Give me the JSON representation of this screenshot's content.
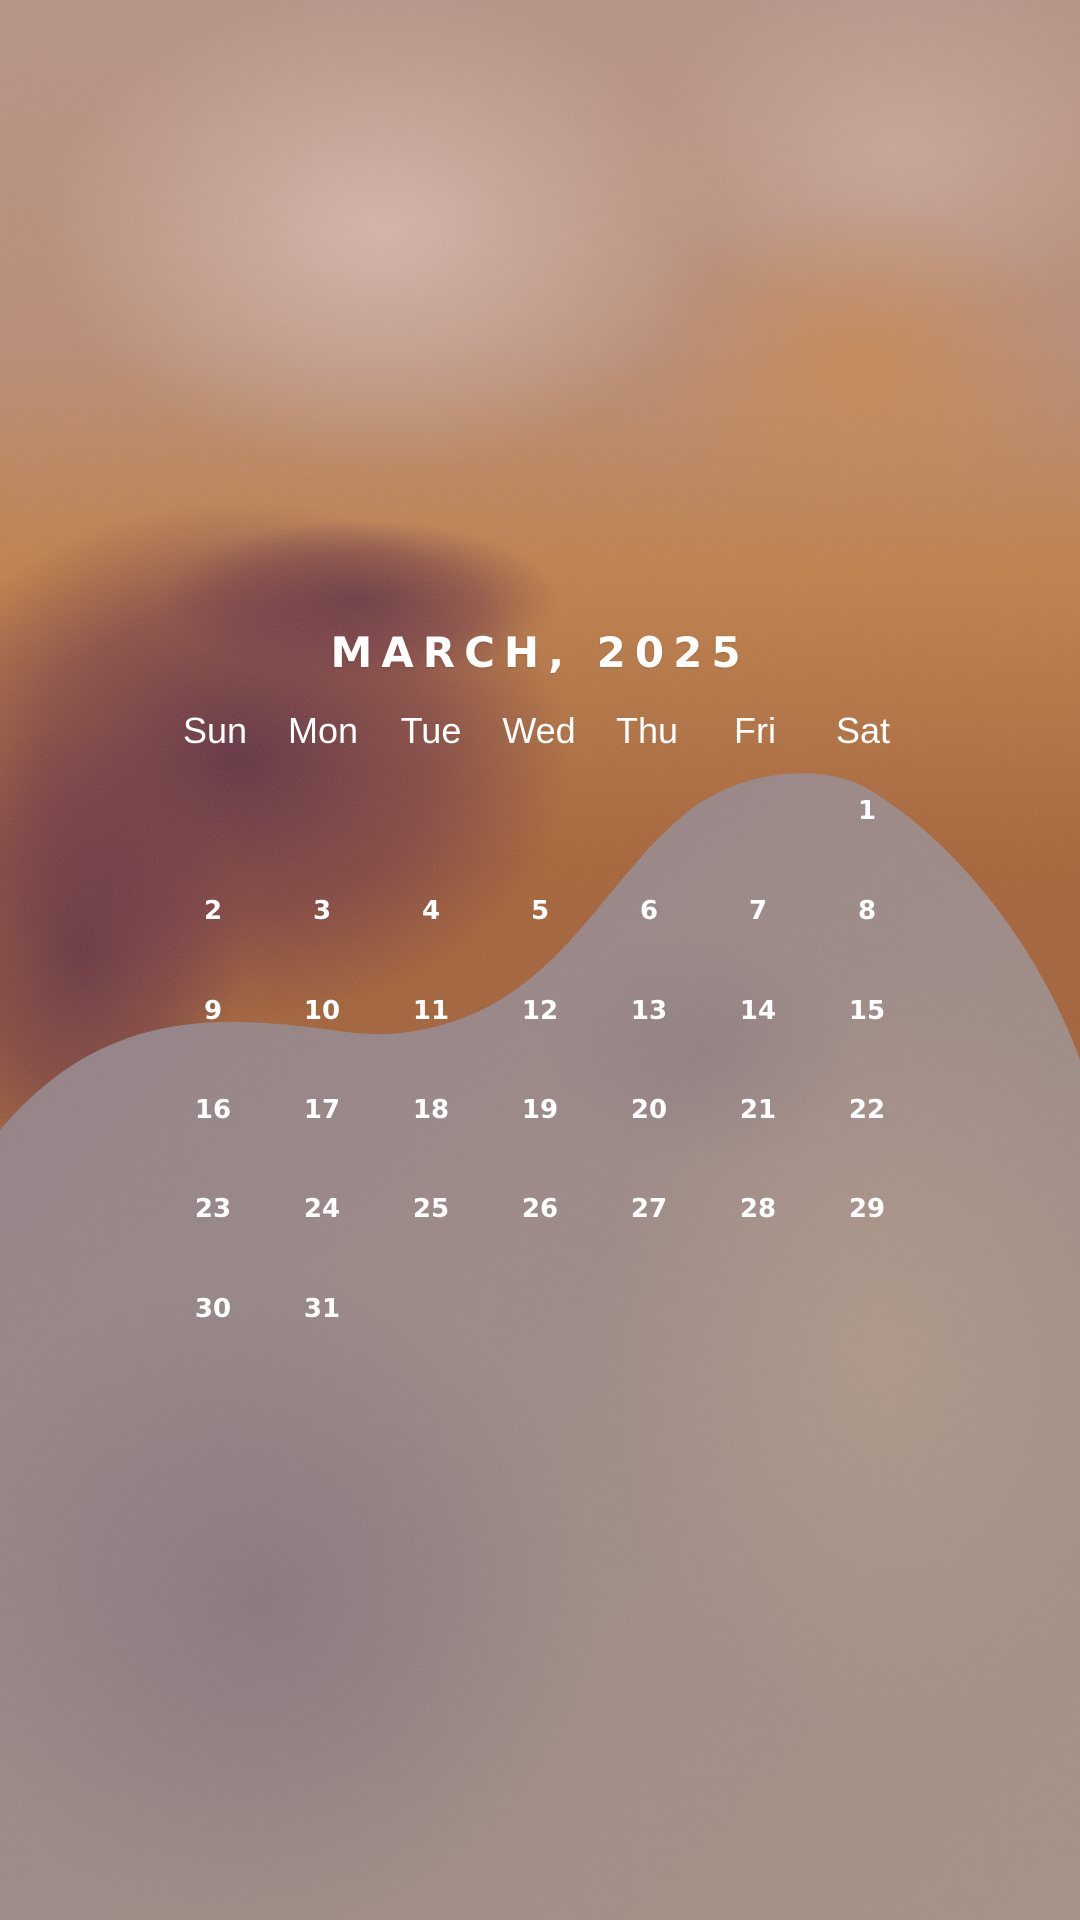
{
  "calendar": {
    "title": "MARCH, 2025",
    "weekdays": [
      "Sun",
      "Mon",
      "Tue",
      "Wed",
      "Thu",
      "Fri",
      "Sat"
    ],
    "first_weekday_index": 6,
    "days": [
      "1",
      "2",
      "3",
      "4",
      "5",
      "6",
      "7",
      "8",
      "9",
      "10",
      "11",
      "12",
      "13",
      "14",
      "15",
      "16",
      "17",
      "18",
      "19",
      "20",
      "21",
      "22",
      "23",
      "24",
      "25",
      "26",
      "27",
      "28",
      "29",
      "30",
      "31"
    ]
  },
  "colors": {
    "text": "#ffffff",
    "background_top": "#b8968b",
    "background_orange": "#c07a3a",
    "background_plum": "#6a3442",
    "wave_overlay": "#9c8a86"
  }
}
